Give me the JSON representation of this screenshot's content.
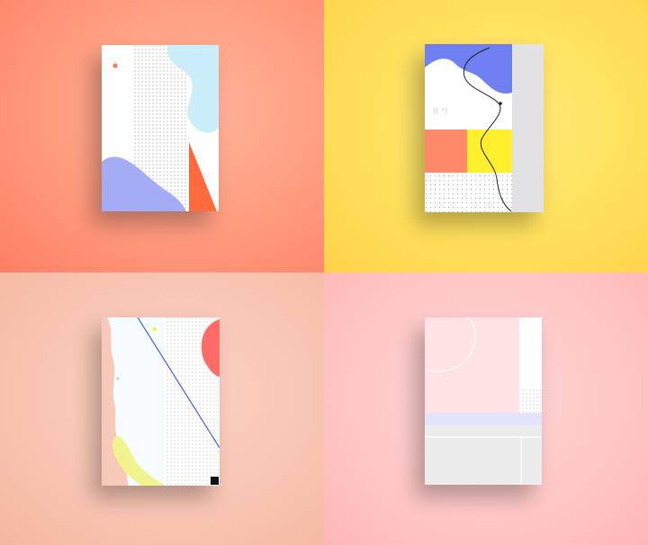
{
  "posters": [
    {
      "name": "coral-poster",
      "bg": "#ff9a7e"
    },
    {
      "name": "yellow-poster",
      "bg": "#ffe05c"
    },
    {
      "name": "peach-poster",
      "bg": "#f8c4b1"
    },
    {
      "name": "pink-poster",
      "bg": "#ffc6c6"
    }
  ],
  "yellow_poster_mark": "II *I"
}
